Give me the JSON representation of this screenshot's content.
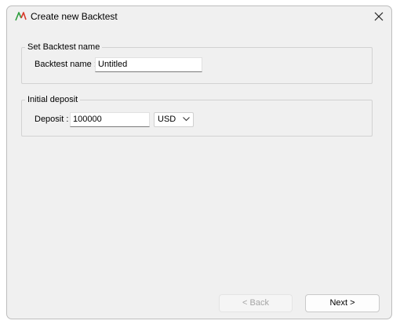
{
  "window": {
    "title": "Create new Backtest",
    "icon": "chart-line-icon",
    "close_icon": "close-icon"
  },
  "name_group": {
    "legend": "Set Backtest name",
    "label": "Backtest name :",
    "value": "Untitled"
  },
  "deposit_group": {
    "legend": "Initial deposit",
    "label": "Deposit :",
    "value": "100000",
    "currency": "USD"
  },
  "buttons": {
    "back": "< Back",
    "next": "Next >",
    "back_enabled": false
  },
  "colors": {
    "icon_green": "#2e9e3e",
    "icon_red": "#d93a2b",
    "disabled_text": "#a5a5a5"
  }
}
